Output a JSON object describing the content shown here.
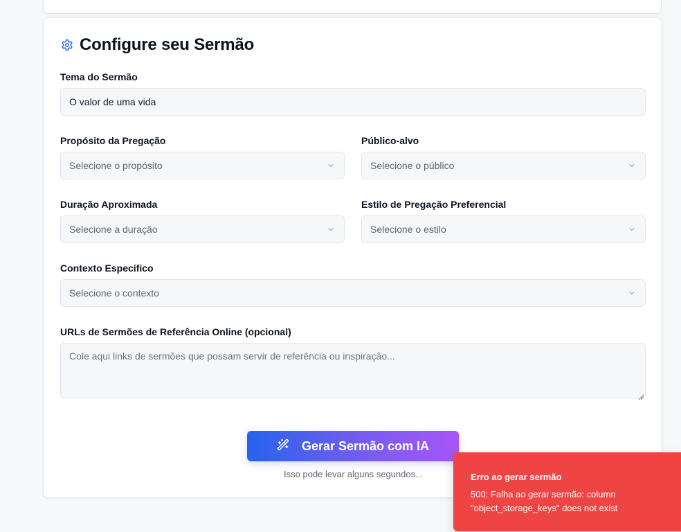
{
  "form": {
    "title": "Configure seu Sermão",
    "theme": {
      "label": "Tema do Sermão",
      "value": "O valor de uma vida"
    },
    "purpose": {
      "label": "Propósito da Pregação",
      "placeholder": "Selecione o propósito"
    },
    "audience": {
      "label": "Público-alvo",
      "placeholder": "Selecione o público"
    },
    "duration": {
      "label": "Duração Aproximada",
      "placeholder": "Selecione a duração"
    },
    "style": {
      "label": "Estilo de Pregação Preferencial",
      "placeholder": "Selecione o estilo"
    },
    "context": {
      "label": "Contexto Específico",
      "placeholder": "Selecione o contexto"
    },
    "urls": {
      "label": "URLs de Sermões de Referência Online (opcional)",
      "placeholder": "Cole aqui links de sermões que possam servir de referência ou inspiração..."
    },
    "generate_label": "Gerar Sermão com IA",
    "hint": "Isso pode levar alguns segundos..."
  },
  "toast": {
    "title": "Erro ao gerar sermão",
    "message": "500: Falha ao gerar sermão: column \"object_storage_keys\" does not exist"
  },
  "colors": {
    "accent": "#2563eb",
    "gradient_end": "#a855f7",
    "error": "#ef4444"
  },
  "icons": {
    "title": "gear-icon",
    "generate": "magic-wand-icon",
    "select": "chevron-down-icon"
  }
}
